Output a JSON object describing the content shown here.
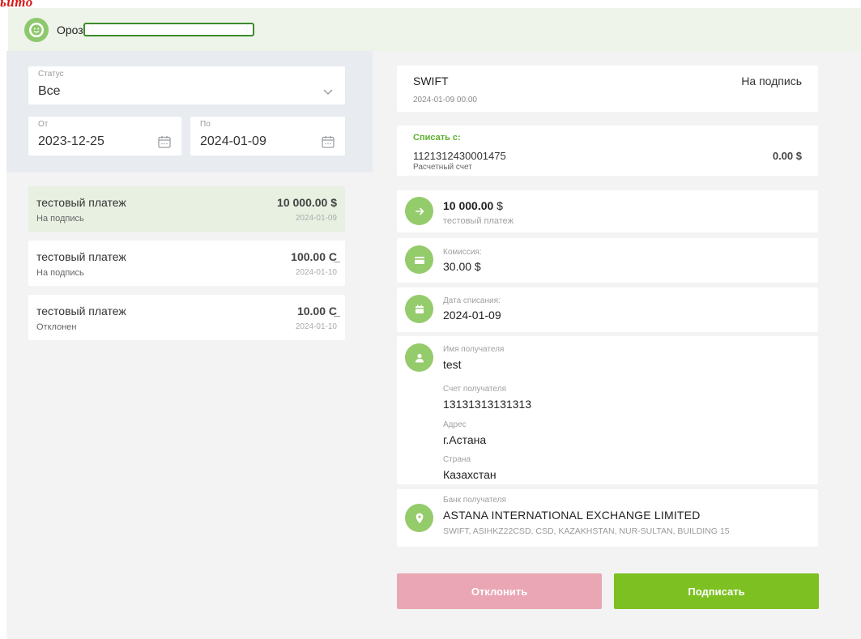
{
  "corner_mark": "ьито",
  "header": {
    "user_name": "Ороз"
  },
  "filters": {
    "status_label": "Статус",
    "status_value": "Все",
    "from_label": "От",
    "from_value": "2023-12-25",
    "to_label": "По",
    "to_value": "2024-01-09"
  },
  "payments": [
    {
      "name": "тестовый платеж",
      "amount": "10 000.00 $",
      "status": "На подпись",
      "date": "2024-01-09"
    },
    {
      "name": "тестовый платеж",
      "amount": "100.00 С̲",
      "status": "На подпись",
      "date": "2024-01-10"
    },
    {
      "name": "тестовый платеж",
      "amount": "10.00 С̲",
      "status": "Отклонен",
      "date": "2024-01-10"
    }
  ],
  "detail": {
    "type": "SWIFT",
    "datetime": "2024-01-09 00:00",
    "status": "На подпись",
    "debit_label": "Списать с:",
    "debit_account": "1121312430001475",
    "debit_account_type": "Расчетный счет",
    "debit_balance": "0.00 $",
    "amount_value": "10 000.00",
    "amount_currency": " $",
    "purpose": "тестовый платеж",
    "commission_label": "Комиссия:",
    "commission_value": "30.00 $",
    "debit_date_label": "Дата списания:",
    "debit_date_value": "2024-01-09",
    "recipient_name_label": "Имя получателя",
    "recipient_name_value": "test",
    "recipient_account_label": "Счет получателя",
    "recipient_account_value": "13131313131313",
    "address_label": "Адрес",
    "address_value": "г.Астана",
    "country_label": "Страна",
    "country_value": "Казахстан",
    "bank_label": "Банк получателя",
    "bank_name": "ASTANA INTERNATIONAL EXCHANGE LIMITED",
    "bank_details": "SWIFT, ASIHKZ22CSD, CSD, KAZAKHSTAN, NUR-SULTAN, BUILDING 15"
  },
  "actions": {
    "reject_label": "Отклонить",
    "sign_label": "Подписать"
  },
  "colors": {
    "accent_green": "#7cc121",
    "icon_green": "#94cb6b",
    "reject_pink": "#eaa6b4",
    "active_row": "#e8f0e2",
    "debit_label_green": "#5db02e"
  },
  "icons": {
    "user": "user-avatar-icon",
    "select": "chevron-down-icon",
    "date": "calendar-icon",
    "amount": "arrow-right-icon",
    "commission": "card-icon",
    "debit_date": "calendar-icon",
    "recipient": "person-icon",
    "bank": "location-pin-icon"
  }
}
